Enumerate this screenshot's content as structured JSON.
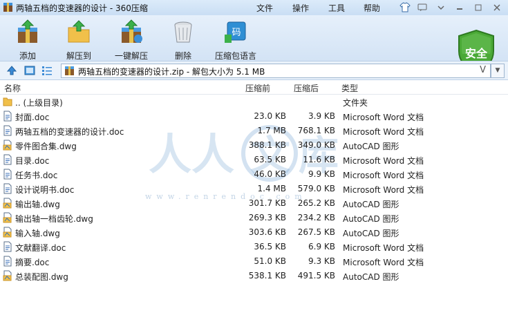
{
  "window": {
    "title": "两轴五档的变速器的设计 - 360压缩",
    "menus": [
      "文件",
      "操作",
      "工具",
      "帮助"
    ]
  },
  "toolbar": {
    "buttons": [
      {
        "label": "添加",
        "icon": "add-archive-icon"
      },
      {
        "label": "解压到",
        "icon": "extract-to-icon"
      },
      {
        "label": "一键解压",
        "icon": "one-click-extract-icon"
      },
      {
        "label": "删除",
        "icon": "delete-trash-icon"
      },
      {
        "label": "压缩包语言",
        "icon": "archive-language-icon"
      }
    ],
    "security_badge": "安全"
  },
  "address": {
    "path": "两轴五档的变速器的设计.zip - 解包大小为 5.1 MB",
    "v_mark": "V"
  },
  "columns": {
    "name": "名称",
    "size": "压缩前",
    "packed": "压缩后",
    "type": "类型"
  },
  "files": [
    {
      "name": ".. (上级目录)",
      "size": "",
      "packed": "",
      "type": "文件夹",
      "icon": "folder-icon"
    },
    {
      "name": "封面.doc",
      "size": "23.0 KB",
      "packed": "3.9 KB",
      "type": "Microsoft Word 文档",
      "icon": "doc-file-icon"
    },
    {
      "name": "两轴五档的变速器的设计.doc",
      "size": "1.7 MB",
      "packed": "768.1 KB",
      "type": "Microsoft Word 文档",
      "icon": "doc-file-icon"
    },
    {
      "name": "零件图合集.dwg",
      "size": "388.1 KB",
      "packed": "349.0 KB",
      "type": "AutoCAD 图形",
      "icon": "dwg-file-icon"
    },
    {
      "name": "目录.doc",
      "size": "63.5 KB",
      "packed": "11.6 KB",
      "type": "Microsoft Word 文档",
      "icon": "doc-file-icon"
    },
    {
      "name": "任务书.doc",
      "size": "46.0 KB",
      "packed": "9.9 KB",
      "type": "Microsoft Word 文档",
      "icon": "doc-file-icon"
    },
    {
      "name": "设计说明书.doc",
      "size": "1.4 MB",
      "packed": "579.0 KB",
      "type": "Microsoft Word 文档",
      "icon": "doc-file-icon"
    },
    {
      "name": "输出轴.dwg",
      "size": "301.7 KB",
      "packed": "265.2 KB",
      "type": "AutoCAD 图形",
      "icon": "dwg-file-icon"
    },
    {
      "name": "输出轴一档齿轮.dwg",
      "size": "269.3 KB",
      "packed": "234.2 KB",
      "type": "AutoCAD 图形",
      "icon": "dwg-file-icon"
    },
    {
      "name": "输入轴.dwg",
      "size": "303.6 KB",
      "packed": "267.5 KB",
      "type": "AutoCAD 图形",
      "icon": "dwg-file-icon"
    },
    {
      "name": "文献翻译.doc",
      "size": "36.5 KB",
      "packed": "6.9 KB",
      "type": "Microsoft Word 文档",
      "icon": "doc-file-icon"
    },
    {
      "name": "摘要.doc",
      "size": "51.0 KB",
      "packed": "9.3 KB",
      "type": "Microsoft Word 文档",
      "icon": "doc-file-icon"
    },
    {
      "name": "总装配图.dwg",
      "size": "538.1 KB",
      "packed": "491.5 KB",
      "type": "AutoCAD 图形",
      "icon": "dwg-file-icon"
    }
  ],
  "watermark": "www.renrendoc.com",
  "colors": {
    "accent": "#2a74c9",
    "security_green": "#3c9b2c",
    "toolbar_bg": "#dce9f7"
  }
}
